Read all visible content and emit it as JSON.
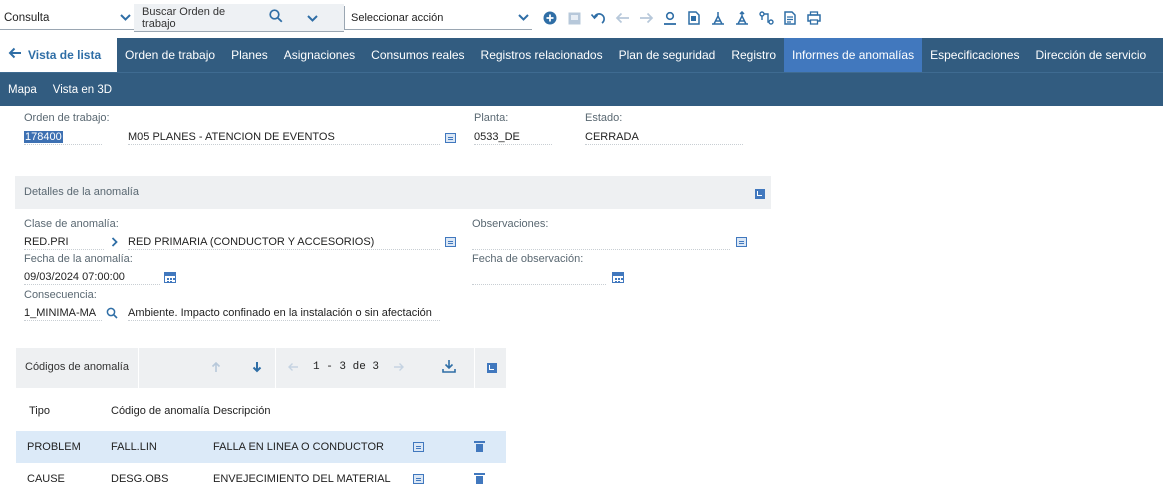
{
  "toolbar": {
    "query_select": "Consulta",
    "search_placeholder": "Buscar Orden de trabajo",
    "action_select": "Seleccionar acción",
    "icons": [
      "add-icon",
      "save-icon",
      "undo-icon",
      "arrow-left-icon",
      "arrow-right-icon",
      "user-icon",
      "document-icon",
      "route-icon",
      "route-alt-icon",
      "workflow-icon",
      "report-icon",
      "print-icon"
    ]
  },
  "tabs": {
    "back_label": "Vista de lista",
    "items": [
      "Orden de trabajo",
      "Planes",
      "Asignaciones",
      "Consumos reales",
      "Registros relacionados",
      "Plan de seguridad",
      "Registro",
      "Informes de anomalías",
      "Especificaciones",
      "Dirección de servicio"
    ],
    "active": "Informes de anomalías",
    "sub_items": [
      "Mapa",
      "Vista en 3D"
    ]
  },
  "header_fields": {
    "work_order_label": "Orden de trabajo:",
    "work_order_value": "178400",
    "work_order_desc": "M05  PLANES - ATENCION DE EVENTOS",
    "plant_label": "Planta:",
    "plant_value": "0533_DE",
    "status_label": "Estado:",
    "status_value": "CERRADA"
  },
  "anomaly_details": {
    "section_title": "Detalles de la anomalía",
    "class_label": "Clase de anomalía:",
    "class_value": "RED.PRI",
    "class_desc": "RED PRIMARIA (CONDUCTOR Y ACCESORIOS)",
    "observations_label": "Observaciones:",
    "observations_value": "",
    "anomaly_date_label": "Fecha de la anomalía:",
    "anomaly_date_value": "09/03/2024 07:00:00",
    "observation_date_label": "Fecha de observación:",
    "observation_date_value": "",
    "consequence_label": "Consecuencia:",
    "consequence_value": "1_MINIMA-MA",
    "consequence_desc": "Ambiente. Impacto confinado en la instalación o sin afectación"
  },
  "codes_table": {
    "title": "Códigos de anomalía",
    "pagination": "1 - 3 de 3",
    "columns": [
      "Tipo",
      "Código de anomalía",
      "Descripción"
    ],
    "rows": [
      {
        "tipo": "PROBLEM",
        "codigo": "FALL.LIN",
        "descripcion": "FALLA EN LINEA O CONDUCTOR"
      },
      {
        "tipo": "CAUSE",
        "codigo": "DESG.OBS",
        "descripcion": "ENVEJECIMIENTO DEL MATERIAL"
      }
    ]
  },
  "colors": {
    "nav_bar": "#325c80",
    "active_tab": "#4178be",
    "accent": "#2f6ea6",
    "selected_row": "#dceaf8",
    "section_bg": "#eef0f2"
  }
}
